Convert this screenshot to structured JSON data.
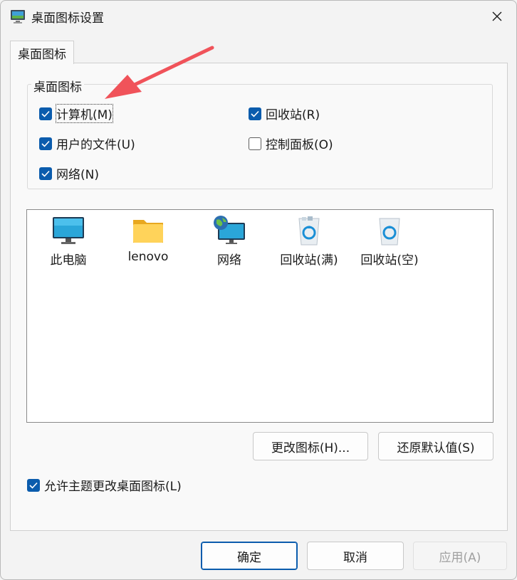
{
  "window": {
    "title": "桌面图标设置"
  },
  "tab": {
    "label": "桌面图标"
  },
  "group": {
    "legend": "桌面图标",
    "checkboxes": [
      {
        "label": "计算机(M)",
        "checked": true
      },
      {
        "label": "回收站(R)",
        "checked": true
      },
      {
        "label": "用户的文件(U)",
        "checked": true
      },
      {
        "label": "控制面板(O)",
        "checked": false
      },
      {
        "label": "网络(N)",
        "checked": true
      }
    ]
  },
  "icons": [
    {
      "label": "此电脑",
      "icon": "computer-icon"
    },
    {
      "label": "lenovo",
      "icon": "folder-icon"
    },
    {
      "label": "网络",
      "icon": "network-icon"
    },
    {
      "label": "回收站(满)",
      "icon": "recycle-bin-full-icon"
    },
    {
      "label": "回收站(空)",
      "icon": "recycle-bin-empty-icon"
    }
  ],
  "buttons": {
    "change_icon": "更改图标(H)...",
    "restore_default": "还原默认值(S)",
    "ok": "确定",
    "cancel": "取消",
    "apply": "应用(A)"
  },
  "allow_theme": {
    "label": "允许主题更改桌面图标(L)",
    "checked": true
  },
  "colors": {
    "accent": "#0b5cad",
    "arrow": "#f0535a"
  }
}
